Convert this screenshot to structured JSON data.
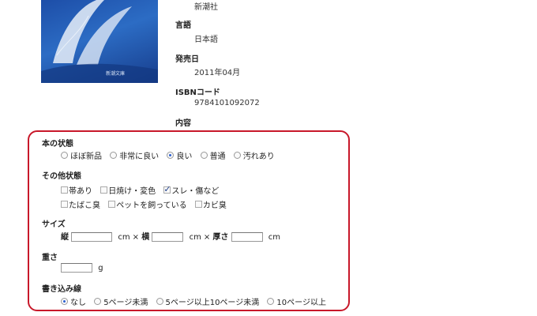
{
  "book": {
    "cover_label": "新潮文庫",
    "publisher_value": "新潮社",
    "language_label": "言語",
    "language_value": "日本語",
    "release_label": "発売日",
    "release_value": "2011年04月",
    "isbn_label": "ISBNコード",
    "isbn_value": "9784101092072",
    "content_label": "内容"
  },
  "form": {
    "condition": {
      "title": "本の状態",
      "options": [
        "ほぼ新品",
        "非常に良い",
        "良い",
        "普通",
        "汚れあり"
      ],
      "selected": "良い"
    },
    "other": {
      "title": "その他状態",
      "options": [
        "帯あり",
        "日焼け・変色",
        "スレ・傷など",
        "たばこ臭",
        "ペットを飼っている",
        "カビ臭"
      ],
      "checked": [
        "スレ・傷など"
      ]
    },
    "size": {
      "title": "サイズ",
      "height_label": "縦",
      "width_label": "横",
      "depth_label": "厚さ",
      "unit": "cm",
      "separator": "×",
      "height_value": "",
      "width_value": "",
      "depth_value": ""
    },
    "weight": {
      "title": "重さ",
      "unit": "g",
      "value": ""
    },
    "writing": {
      "title": "書き込み線",
      "options": [
        "なし",
        "5ページ未満",
        "5ページ以上10ページ未満",
        "10ページ以上"
      ],
      "selected": "なし"
    }
  },
  "colors": {
    "panel_border": "#c8182a",
    "radio_dot": "#2a5fd0",
    "check_mark": "#1f3f8a"
  }
}
